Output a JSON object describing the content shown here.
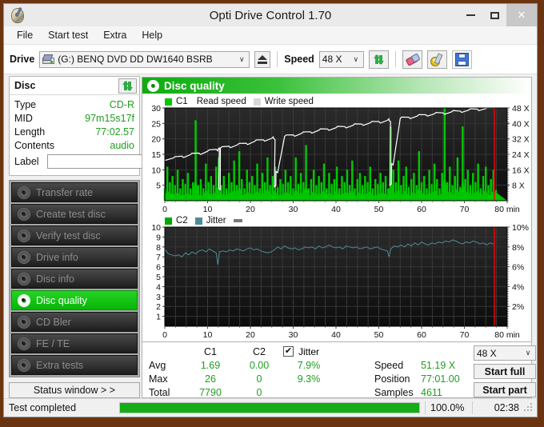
{
  "window": {
    "title": "Opti Drive Control 1.70",
    "app_icon": "disc-pen-icon",
    "minimize": "–",
    "maximize": "□",
    "close": "✕"
  },
  "menu": {
    "items": [
      "File",
      "Start test",
      "Extra",
      "Help"
    ]
  },
  "toolbar": {
    "drive_label": "Drive",
    "drive_value": "(G:)  BENQ DVD DD DW1640 BSRB",
    "eject_title": "Eject",
    "speed_label": "Speed",
    "speed_value": "48 X",
    "arrow": "∨",
    "icons": [
      "refresh-icon",
      "eraser-icon",
      "tools-icon",
      "save-icon"
    ]
  },
  "disc": {
    "header": "Disc",
    "rows": [
      {
        "key": "Type",
        "value": "CD-R"
      },
      {
        "key": "MID",
        "value": "97m15s17f"
      },
      {
        "key": "Length",
        "value": "77:02.57"
      },
      {
        "key": "Contents",
        "value": "audio"
      }
    ],
    "label_key": "Label",
    "label_value": "",
    "label_placeholder": ""
  },
  "nav": {
    "items": [
      {
        "label": "Transfer rate",
        "active": false
      },
      {
        "label": "Create test disc",
        "active": false
      },
      {
        "label": "Verify test disc",
        "active": false
      },
      {
        "label": "Drive info",
        "active": false
      },
      {
        "label": "Disc info",
        "active": false
      },
      {
        "label": "Disc quality",
        "active": true
      },
      {
        "label": "CD Bler",
        "active": false
      },
      {
        "label": "FE / TE",
        "active": false
      },
      {
        "label": "Extra tests",
        "active": false
      }
    ],
    "status_window": "Status window > >"
  },
  "panel": {
    "title": "Disc quality",
    "icon": "disc-quality-icon"
  },
  "stats": {
    "col_c1": "C1",
    "col_c2": "C2",
    "jitter_label": "Jitter",
    "jitter_checked": true,
    "check_glyph": "✔",
    "rows": [
      {
        "key": "Avg",
        "c1": "1.69",
        "c2": "0.00",
        "jitter": "7.9%"
      },
      {
        "key": "Max",
        "c1": "26",
        "c2": "0",
        "jitter": "9.3%"
      },
      {
        "key": "Total",
        "c1": "7790",
        "c2": "0",
        "jitter": ""
      }
    ],
    "speed_key": "Speed",
    "speed_value": "51.19 X",
    "position_key": "Position",
    "position_value": "77:01.00",
    "samples_key": "Samples",
    "samples_value": "4611",
    "speed_select": "48 X",
    "start_full": "Start full",
    "start_part": "Start part"
  },
  "statusbar": {
    "text": "Test completed",
    "percent": "100.0%",
    "progress_value": 100,
    "time": "02:38"
  },
  "chart_data": [
    {
      "type": "area",
      "name": "c1-chart",
      "title": "",
      "legend": [
        {
          "label": "C1",
          "color": "#00c800",
          "swatch": true
        },
        {
          "label": "Read speed",
          "color": "#ffffff",
          "swatch": false
        },
        {
          "label": "Write speed",
          "color": "#d8d8d8",
          "swatch": true
        }
      ],
      "xlabel": "min",
      "xlim": [
        0,
        80
      ],
      "xticks": [
        0,
        10,
        20,
        30,
        40,
        50,
        60,
        70,
        80
      ],
      "ylabel_left": "C1",
      "ylim": [
        0,
        30
      ],
      "yticks_left": [
        5,
        10,
        15,
        20,
        25,
        30
      ],
      "ylabel_right": "X",
      "ylim_right": [
        0,
        48
      ],
      "yticks_right": [
        "8 X",
        "16 X",
        "24 X",
        "32 X",
        "40 X",
        "48 X"
      ],
      "grid": true,
      "background": "#141414",
      "marker_line_x": 77.0,
      "marker_color": "#ff0000",
      "series": [
        {
          "name": "C1",
          "color": "#00c800",
          "kind": "spikes",
          "x": [
            0,
            0.6,
            1.2,
            1.8,
            2.4,
            3,
            3.6,
            4.2,
            4.8,
            5.4,
            6,
            6.6,
            7.2,
            7.8,
            8.4,
            9,
            9.6,
            10.2,
            10.8,
            11.4,
            12,
            12.6,
            13.2,
            13.8,
            14.4,
            15,
            15.6,
            16.2,
            16.8,
            17.4,
            18,
            18.6,
            19.2,
            19.8,
            20.4,
            21,
            21.6,
            22.2,
            22.8,
            23.4,
            24,
            24.6,
            25.2,
            25.8,
            26.4,
            27,
            27.6,
            28.2,
            28.8,
            29.4,
            30,
            30.6,
            31.2,
            31.8,
            32.4,
            33,
            33.6,
            34.2,
            34.8,
            35.4,
            36,
            36.6,
            37.2,
            37.8,
            38.4,
            39,
            39.6,
            40.2,
            40.8,
            41.4,
            42,
            42.6,
            43.2,
            43.8,
            44.4,
            45,
            45.6,
            46.2,
            46.8,
            47.4,
            48,
            48.6,
            49.2,
            49.8,
            50.4,
            51,
            51.6,
            52.2,
            52.8,
            53.4,
            54,
            54.6,
            55.2,
            55.8,
            56.4,
            57,
            57.6,
            58.2,
            58.8,
            59.4,
            60,
            60.6,
            61.2,
            61.8,
            62.4,
            63,
            63.6,
            64.2,
            64.8,
            65.4,
            66,
            66.6,
            67.2,
            67.8,
            68.4,
            69,
            69.6,
            70.2,
            70.8,
            71.4,
            72,
            72.6,
            73.2,
            73.8,
            74.4,
            75,
            75.6,
            76.2,
            76.8
          ],
          "y": [
            4,
            11,
            6,
            8,
            5,
            10,
            4,
            7,
            5,
            9,
            4,
            6,
            26,
            5,
            7,
            4,
            12,
            6,
            8,
            5,
            11,
            14,
            5,
            8,
            4,
            9,
            6,
            13,
            5,
            16,
            7,
            4,
            10,
            6,
            8,
            5,
            12,
            4,
            9,
            6,
            14,
            5,
            8,
            11,
            4,
            7,
            5,
            10,
            6,
            8,
            4,
            14,
            5,
            9,
            6,
            18,
            4,
            7,
            10,
            5,
            8,
            6,
            12,
            4,
            9,
            5,
            7,
            11,
            4,
            8,
            6,
            10,
            5,
            13,
            4,
            7,
            9,
            5,
            8,
            6,
            11,
            4,
            7,
            5,
            9,
            6,
            8,
            4,
            24,
            10,
            6,
            13,
            5,
            8,
            11,
            4,
            7,
            9,
            5,
            16,
            6,
            8,
            4,
            10,
            5,
            12,
            7,
            4,
            9,
            33,
            6,
            11,
            5,
            8,
            14,
            4,
            24,
            7,
            10,
            5,
            9,
            6,
            12,
            4,
            8,
            11,
            5,
            7,
            10,
            6,
            9,
            4
          ]
        },
        {
          "name": "Read speed",
          "color": "#ffffff",
          "kind": "line",
          "x": [
            0,
            2,
            4,
            6,
            8,
            10,
            12,
            12.4,
            12.6,
            13,
            15,
            17,
            19,
            21,
            23,
            25,
            25.4,
            25.6,
            26,
            28,
            30,
            32,
            34,
            36,
            38,
            40,
            42,
            44,
            46,
            48,
            50,
            52,
            52.4,
            52.6,
            53,
            55,
            57,
            59,
            61,
            63,
            65,
            67,
            69,
            71,
            73,
            75,
            77
          ],
          "y": [
            13.0,
            13.8,
            14.4,
            14.9,
            15.4,
            16.0,
            16.6,
            16.6,
            4.0,
            17.0,
            17.6,
            18.1,
            18.6,
            19.2,
            19.7,
            20.2,
            20.2,
            4.5,
            9.5,
            20.8,
            21.3,
            21.8,
            22.3,
            22.8,
            23.2,
            23.6,
            24.0,
            24.4,
            24.8,
            25.2,
            25.6,
            26.0,
            26.0,
            5.0,
            12.0,
            26.6,
            27.0,
            27.4,
            27.8,
            28.1,
            28.4,
            28.7,
            29.0,
            29.3,
            29.6,
            29.8,
            30.0
          ]
        }
      ]
    },
    {
      "type": "line",
      "name": "c2-jitter-chart",
      "title": "",
      "legend": [
        {
          "label": "C2",
          "color": "#00a800",
          "swatch": true
        },
        {
          "label": "Jitter",
          "color": "#4e8b96",
          "swatch": true
        }
      ],
      "xlabel": "min",
      "xlim": [
        0,
        80
      ],
      "xticks": [
        0,
        10,
        20,
        30,
        40,
        50,
        60,
        70,
        80
      ],
      "ylabel_left": "C2",
      "ylim": [
        0,
        10
      ],
      "yticks_left": [
        1,
        2,
        3,
        4,
        5,
        6,
        7,
        8,
        9,
        10
      ],
      "ylabel_right": "%",
      "ylim_right": [
        0,
        10
      ],
      "yticks_right": [
        "2%",
        "4%",
        "6%",
        "8%",
        "10%"
      ],
      "grid": true,
      "background": "#1a1a1a",
      "marker_line_x": 77.0,
      "marker_color": "#ff0000",
      "series": [
        {
          "name": "Jitter",
          "color": "#4e8b96",
          "kind": "line",
          "x": [
            0,
            0.8,
            1.6,
            2.4,
            3.2,
            4,
            4.8,
            5.6,
            6.4,
            7.2,
            8,
            8.8,
            9.6,
            10.4,
            11.2,
            12,
            12.4,
            12.8,
            13.6,
            14.4,
            15.2,
            16,
            16.8,
            17.6,
            18.4,
            19.2,
            20,
            20.8,
            21.6,
            22.4,
            23.2,
            24,
            24.8,
            25.6,
            26.4,
            27.2,
            28,
            28.8,
            29.6,
            30.4,
            31.2,
            32,
            32.8,
            33.6,
            34.4,
            35.2,
            36,
            36.8,
            37.6,
            38.4,
            39.2,
            40,
            40.8,
            41.6,
            42.4,
            43.2,
            44,
            44.8,
            45.6,
            46.4,
            47.2,
            48,
            48.8,
            49.6,
            50.4,
            51.2,
            52,
            52.4,
            52.8,
            53.6,
            54.4,
            55.2,
            56,
            56.8,
            57.6,
            58.4,
            59.2,
            60,
            60.8,
            61.6,
            62.4,
            63.2,
            64,
            64.8,
            65.6,
            66.4,
            67.2,
            68,
            68.8,
            69.6,
            70.4,
            71.2,
            72,
            72.8,
            73.6,
            74.4,
            75.2,
            76,
            76.8
          ],
          "y": [
            7.8,
            7.3,
            7.2,
            7.1,
            7.2,
            7.0,
            7.4,
            7.2,
            7.5,
            7.3,
            7.6,
            7.7,
            7.5,
            7.8,
            7.6,
            7.4,
            6.2,
            7.5,
            7.6,
            7.5,
            7.7,
            7.6,
            7.8,
            7.7,
            7.6,
            7.8,
            7.9,
            7.7,
            7.8,
            7.6,
            7.5,
            7.4,
            7.5,
            7.7,
            8.0,
            7.8,
            8.1,
            7.9,
            7.8,
            7.9,
            7.7,
            7.8,
            8.0,
            7.9,
            8.0,
            7.8,
            8.1,
            7.9,
            8.0,
            8.2,
            8.0,
            7.9,
            8.0,
            7.8,
            8.1,
            8.0,
            7.9,
            8.0,
            7.8,
            7.9,
            8.0,
            7.8,
            7.9,
            8.0,
            7.8,
            7.7,
            7.6,
            7.0,
            7.8,
            8.1,
            8.0,
            8.2,
            8.0,
            8.3,
            8.1,
            8.4,
            8.2,
            8.5,
            8.3,
            8.2,
            8.4,
            8.3,
            8.5,
            8.4,
            8.6,
            8.5,
            8.7,
            8.6,
            8.4,
            8.3,
            8.5,
            8.4,
            8.6,
            8.5,
            8.3,
            8.4,
            8.2,
            8.4,
            8.3
          ]
        }
      ]
    }
  ]
}
